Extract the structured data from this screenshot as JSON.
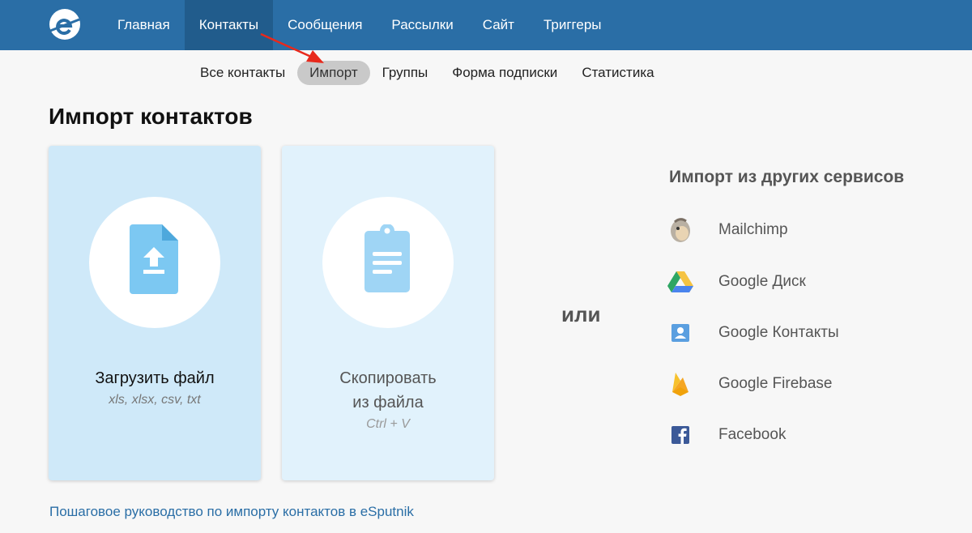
{
  "topnav": {
    "items": [
      {
        "label": "Главная"
      },
      {
        "label": "Контакты",
        "active": true
      },
      {
        "label": "Сообщения"
      },
      {
        "label": "Рассылки"
      },
      {
        "label": "Сайт"
      },
      {
        "label": "Триггеры"
      }
    ]
  },
  "subnav": {
    "items": [
      {
        "label": "Все контакты"
      },
      {
        "label": "Импорт",
        "active": true
      },
      {
        "label": "Группы"
      },
      {
        "label": "Форма подписки"
      },
      {
        "label": "Статистика"
      }
    ]
  },
  "page": {
    "title": "Импорт контактов",
    "or_label": "или",
    "guide_link": "Пошаговое руководство по импорту контактов в eSputnik"
  },
  "cards": {
    "upload": {
      "title": "Загрузить файл",
      "hint": "xls, xlsx, csv, txt",
      "icon": "file-upload-icon"
    },
    "copy": {
      "title_line1": "Скопировать",
      "title_line2": "из файла",
      "hint": "Ctrl + V",
      "icon": "clipboard-icon"
    }
  },
  "services": {
    "title": "Импорт из других сервисов",
    "items": [
      {
        "label": "Mailchimp",
        "icon": "mailchimp-icon"
      },
      {
        "label": "Google Диск",
        "icon": "google-drive-icon"
      },
      {
        "label": "Google Контакты",
        "icon": "google-contacts-icon"
      },
      {
        "label": "Google Firebase",
        "icon": "firebase-icon"
      },
      {
        "label": "Facebook",
        "icon": "facebook-icon"
      }
    ]
  },
  "colors": {
    "nav_bg": "#2a6ea6",
    "nav_active": "#215c8c",
    "card_upload": "#cfe9f9",
    "card_copy": "#e1f2fc",
    "annotation_arrow": "#e8291c"
  }
}
